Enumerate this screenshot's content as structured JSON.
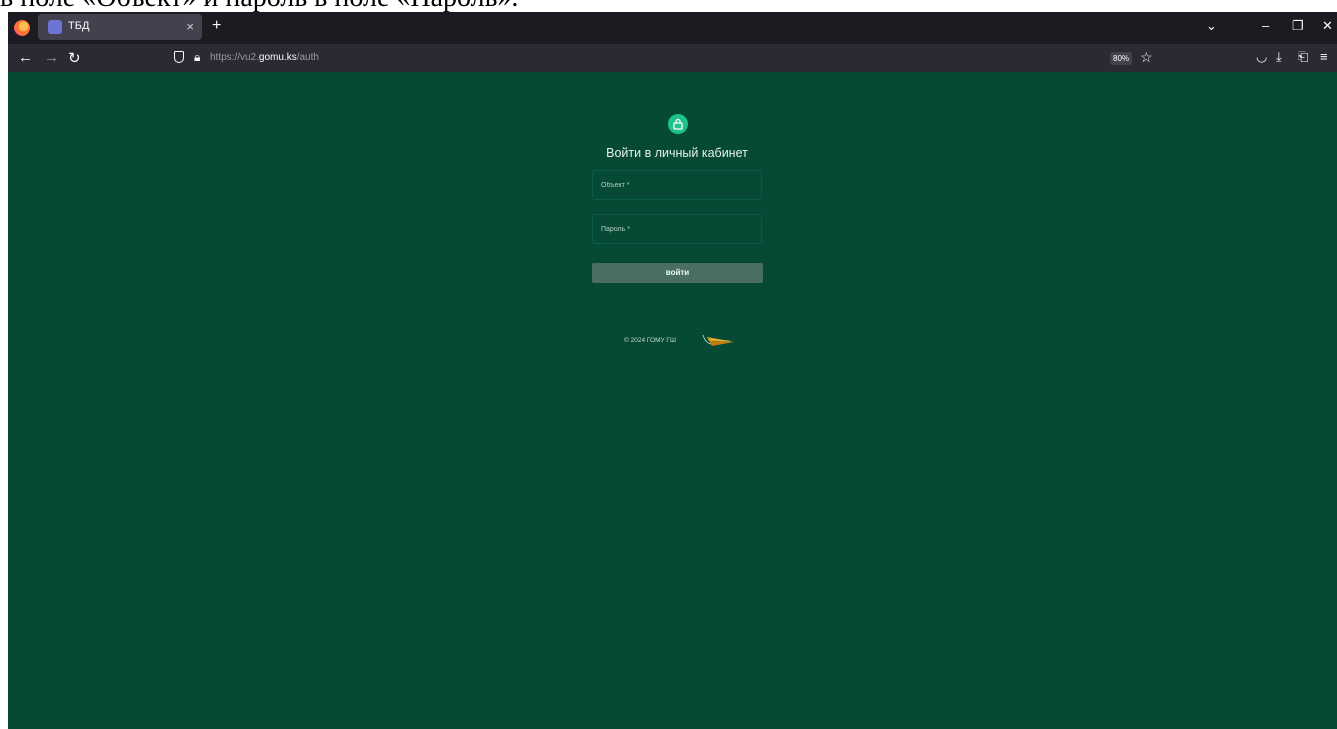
{
  "caption": "в поле «Объект» и пароль в поле «Пароль».",
  "browser": {
    "tab": {
      "title": "ТБД",
      "close": "×"
    },
    "new_tab": "+",
    "window_controls": {
      "list": "⌄",
      "minimize": "–",
      "maximize": "❐",
      "close": "✕"
    },
    "nav": {
      "back": "←",
      "forward": "→",
      "reload": "↻"
    },
    "url": {
      "prefix": "https://vu2.",
      "domain": "gomu.ks",
      "path": "/auth"
    },
    "zoom": "80%",
    "toolbar_icons": [
      "bookmark-star-icon",
      "pocket-icon",
      "download-icon",
      "extensions-icon",
      "menu-icon"
    ]
  },
  "login": {
    "title": "Войти в личный кабинет",
    "object_placeholder": "Объект *",
    "password_placeholder": "Пароль *",
    "submit_label": "войти"
  },
  "footer": {
    "text": "© 2024 ГОМУ ГШ"
  },
  "colors": {
    "page_background": "#064a36",
    "accent": "#1ec28b",
    "button": "#4a6e63"
  }
}
